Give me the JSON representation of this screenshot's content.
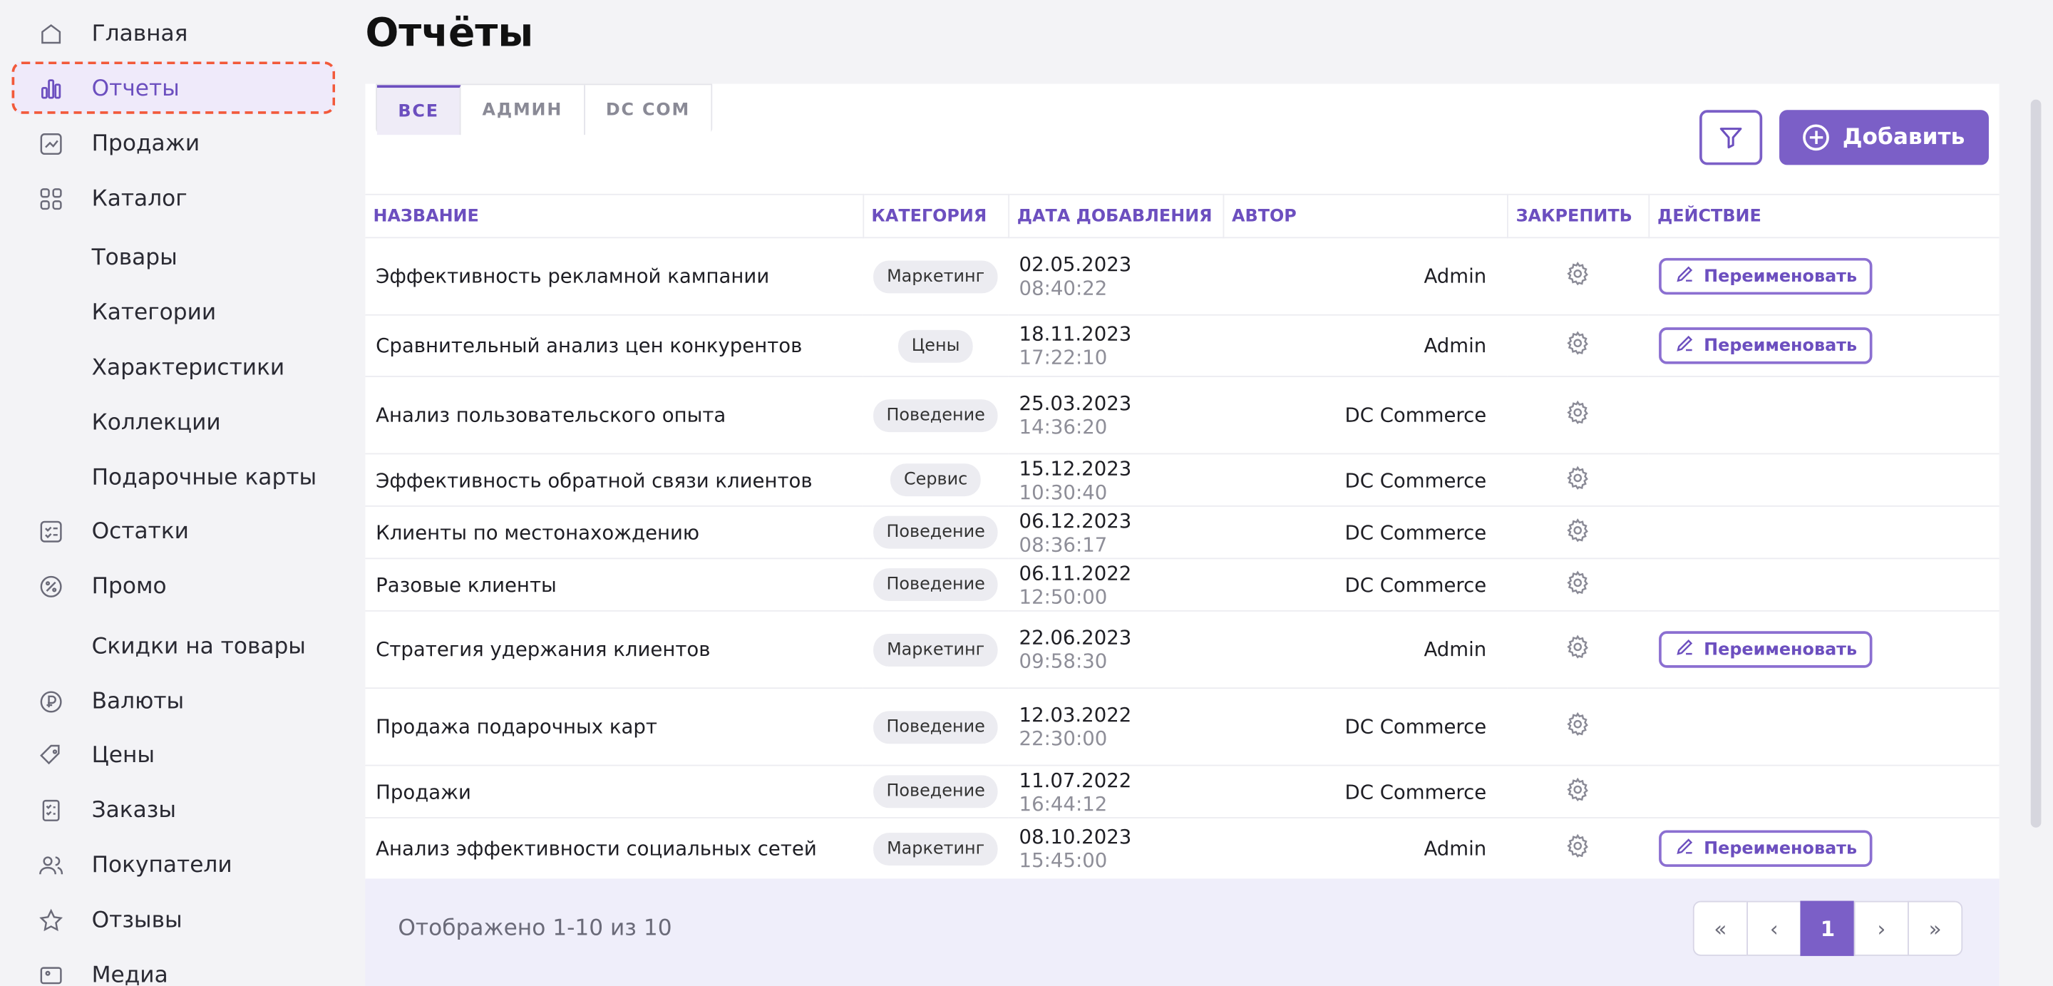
{
  "sidebar": {
    "items": [
      {
        "label": "Главная",
        "icon": "home-icon"
      },
      {
        "label": "Отчеты",
        "icon": "reports-icon",
        "active": true
      },
      {
        "label": "Продажи",
        "icon": "sales-icon"
      },
      {
        "label": "Каталог",
        "icon": "catalog-icon"
      },
      {
        "label": "Товары",
        "sub": true
      },
      {
        "label": "Категории",
        "sub": true
      },
      {
        "label": "Характеристики",
        "sub": true
      },
      {
        "label": "Коллекции",
        "sub": true
      },
      {
        "label": "Подарочные карты",
        "sub": true
      },
      {
        "label": "Остатки",
        "icon": "stock-icon"
      },
      {
        "label": "Промо",
        "icon": "promo-icon"
      },
      {
        "label": "Скидки на товары",
        "sub": true
      },
      {
        "label": "Валюты",
        "icon": "currency-icon"
      },
      {
        "label": "Цены",
        "icon": "price-tag-icon"
      },
      {
        "label": "Заказы",
        "icon": "orders-icon"
      },
      {
        "label": "Покупатели",
        "icon": "customers-icon"
      },
      {
        "label": "Отзывы",
        "icon": "star-icon"
      },
      {
        "label": "Медиа",
        "icon": "media-icon"
      }
    ]
  },
  "page": {
    "title": "Отчёты"
  },
  "tabs": [
    "ВСЕ",
    "АДМИН",
    "DC COM"
  ],
  "toolbar": {
    "add_label": "Добавить"
  },
  "table": {
    "headers": [
      "НАЗВАНИЕ",
      "КАТЕГОРИЯ",
      "ДАТА ДОБАВЛЕНИЯ",
      "АВТОР",
      "ЗАКРЕПИТЬ",
      "ДЕЙСТВИЕ"
    ],
    "rename_label": "Переименовать",
    "rows": [
      {
        "name": "Эффективность рекламной кампании",
        "category": "Маркетинг",
        "date": "02.05.2023",
        "time": "08:40:22",
        "author": "Admin",
        "rename": true
      },
      {
        "name": "Сравнительный анализ цен конкурентов",
        "category": "Цены",
        "date": "18.11.2023",
        "time": "17:22:10",
        "author": "Admin",
        "rename": true
      },
      {
        "name": "Анализ пользовательского опыта",
        "category": "Поведение",
        "date": "25.03.2023",
        "time": "14:36:20",
        "author": "DC Commerce",
        "rename": false
      },
      {
        "name": "Эффективность обратной связи клиентов",
        "category": "Сервис",
        "date": "15.12.2023",
        "time": "10:30:40",
        "author": "DC Commerce",
        "rename": false
      },
      {
        "name": "Клиенты по местонахождению",
        "category": "Поведение",
        "date": "06.12.2023",
        "time": "08:36:17",
        "author": "DC Commerce",
        "rename": false
      },
      {
        "name": "Разовые клиенты",
        "category": "Поведение",
        "date": "06.11.2022",
        "time": "12:50:00",
        "author": "DC Commerce",
        "rename": false
      },
      {
        "name": "Стратегия удержания клиентов",
        "category": "Маркетинг",
        "date": "22.06.2023",
        "time": "09:58:30",
        "author": "Admin",
        "rename": true
      },
      {
        "name": "Продажа подарочных карт",
        "category": "Поведение",
        "date": "12.03.2022",
        "time": "22:30:00",
        "author": "DC Commerce",
        "rename": false
      },
      {
        "name": "Продажи",
        "category": "Поведение",
        "date": "11.07.2022",
        "time": "16:44:12",
        "author": "DC Commerce",
        "rename": false
      },
      {
        "name": "Анализ эффективности социальных сетей",
        "category": "Маркетинг",
        "date": "08.10.2023",
        "time": "15:45:00",
        "author": "Admin",
        "rename": true
      }
    ]
  },
  "footer": {
    "shown_text": "Отображено 1-10 из 10",
    "pages": [
      "«",
      "‹",
      "1",
      "›",
      "»"
    ],
    "current_page": "1"
  }
}
